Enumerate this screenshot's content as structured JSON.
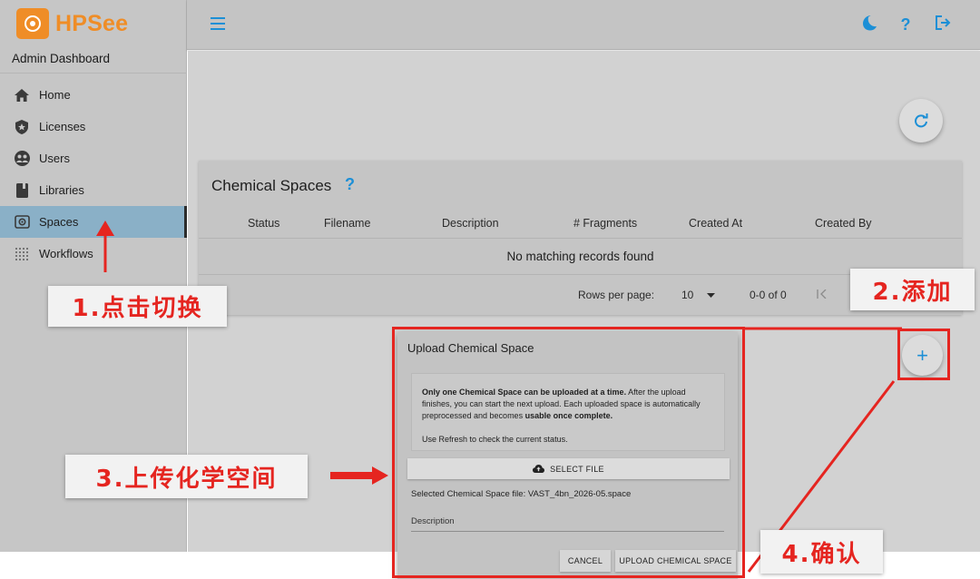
{
  "app": {
    "name": "HPSee",
    "subtitle": "Admin Dashboard"
  },
  "sidebar": {
    "items": [
      {
        "label": "Home",
        "icon": "home-icon"
      },
      {
        "label": "Licenses",
        "icon": "badge-icon"
      },
      {
        "label": "Users",
        "icon": "users-icon"
      },
      {
        "label": "Libraries",
        "icon": "book-icon"
      },
      {
        "label": "Spaces",
        "icon": "spaces-icon",
        "active": true
      },
      {
        "label": "Workflows",
        "icon": "workflows-icon"
      }
    ]
  },
  "topbar": {
    "icons": [
      "menu-icon",
      "dark-mode-icon",
      "help-icon",
      "logout-icon"
    ],
    "help_glyph": "?"
  },
  "table": {
    "title": "Chemical Spaces",
    "help_glyph": "?",
    "columns": [
      "Status",
      "Filename",
      "Description",
      "# Fragments",
      "Created At",
      "Created By"
    ],
    "empty_text": "No matching records found",
    "rows_per_page_label": "Rows per page:",
    "rows_per_page_value": "10",
    "range_text": "0-0 of 0"
  },
  "dialog": {
    "title": "Upload Chemical Space",
    "notice_bold_1": "Only one Chemical Space can be uploaded at a time.",
    "notice_text_1": " After the upload finishes, you can start the next upload. Each uploaded space is automatically preprocessed and becomes ",
    "notice_bold_2": "usable once complete.",
    "notice_text_2": "Use Refresh to check the current status.",
    "select_file_label": "SELECT FILE",
    "selected_file_text": "Selected Chemical Space file: VAST_4bn_2026-05.space",
    "description_label": "Description",
    "cancel_label": "CANCEL",
    "upload_label": "UPLOAD CHEMICAL SPACE"
  },
  "add_fab_glyph": "+",
  "annotations": {
    "step1": "1.点击切换",
    "step2": "2.添加",
    "step3": "3.上传化学空间",
    "step4": "4.确认",
    "color": "#e52520"
  }
}
